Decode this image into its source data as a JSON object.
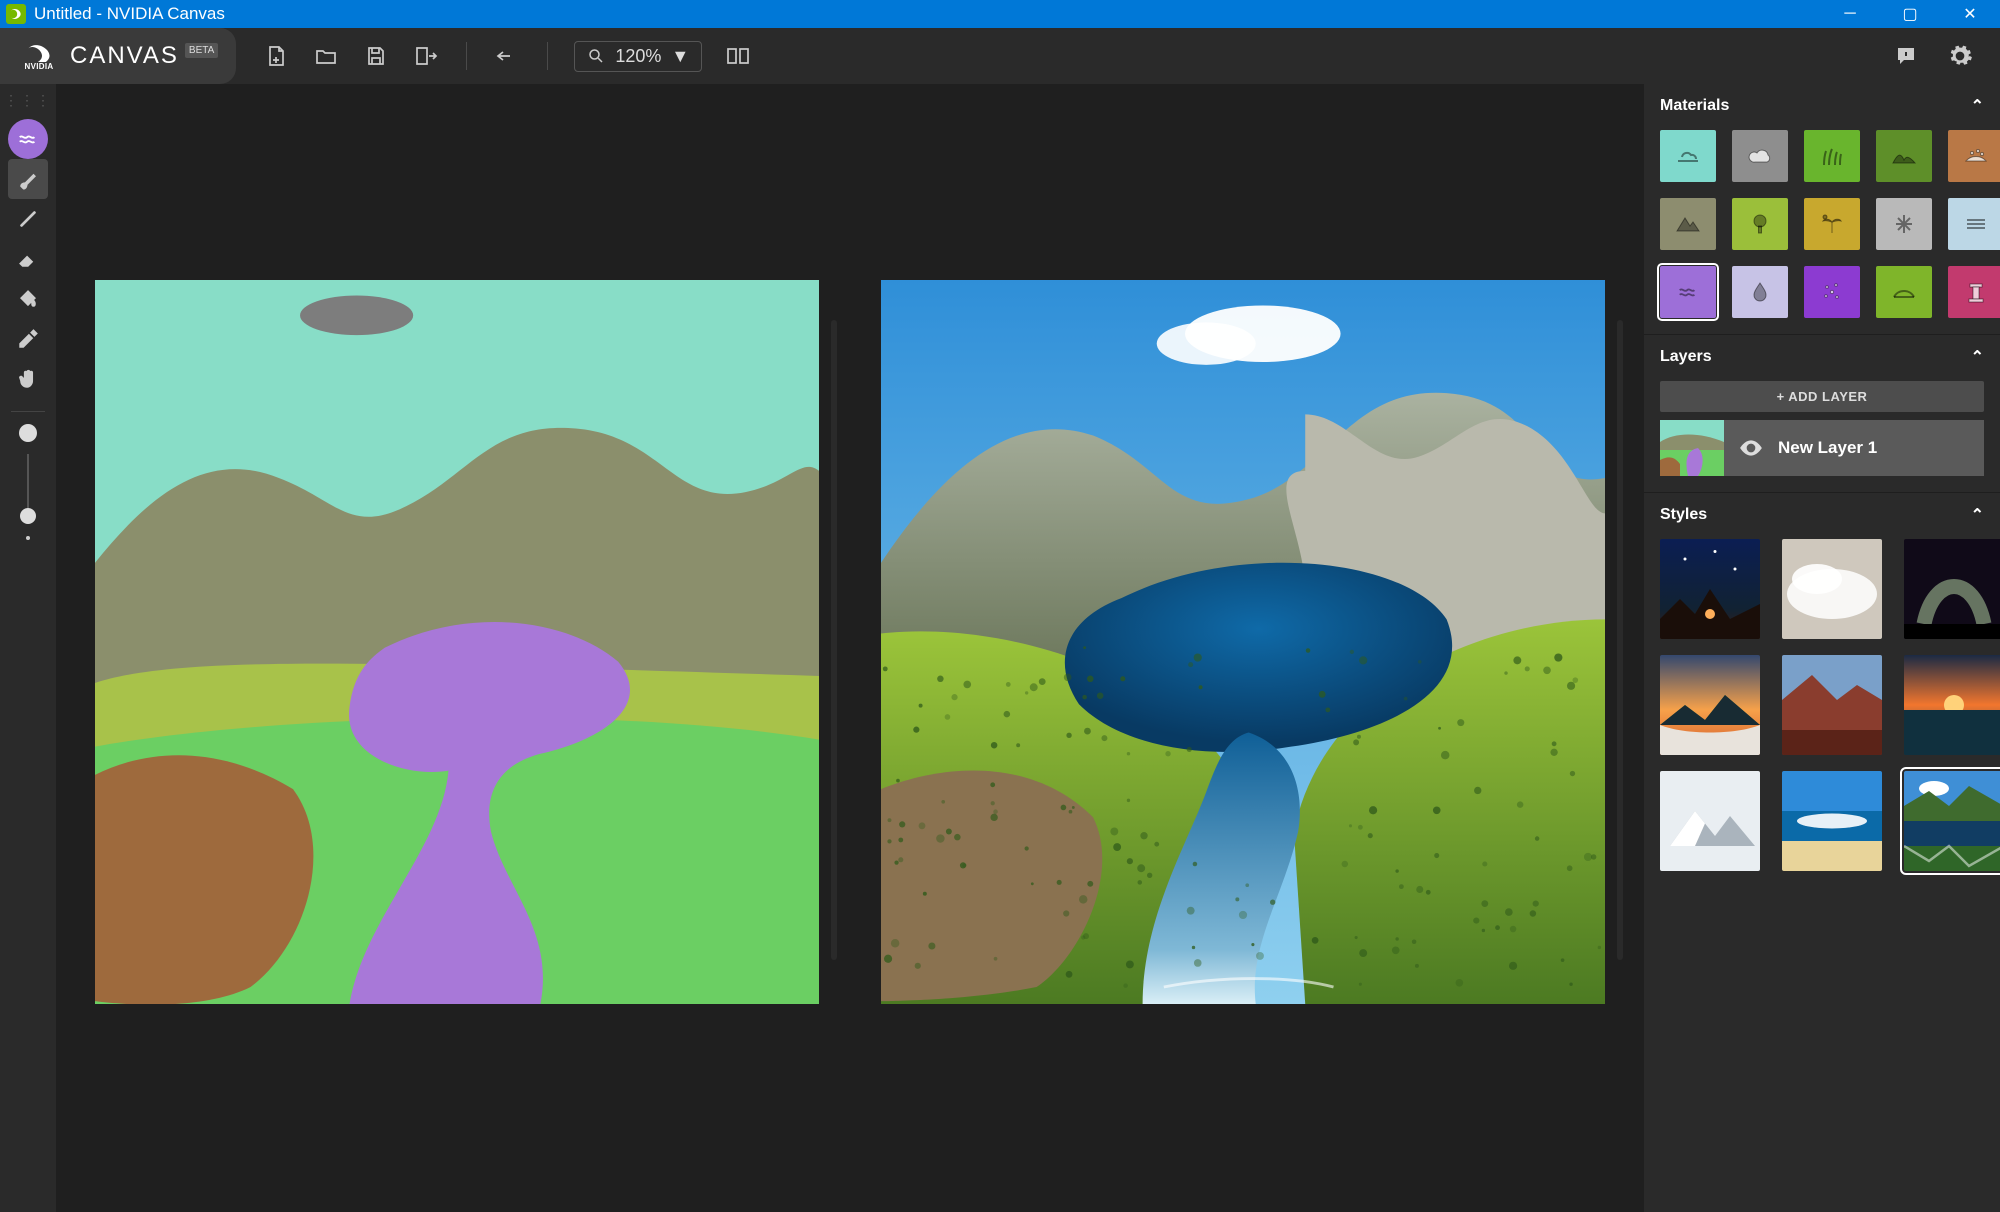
{
  "window": {
    "title": "Untitled - NVIDIA Canvas"
  },
  "brand": {
    "logo_text": "NVIDIA",
    "app_name": "CANVAS",
    "beta": "BETA"
  },
  "toolbar": {
    "zoom_value": "120%"
  },
  "left_tools": [
    {
      "name": "current-material-badge",
      "icon": "waves",
      "interact": true,
      "badge": true
    },
    {
      "name": "brush-tool",
      "icon": "brush",
      "interact": true,
      "selected": true
    },
    {
      "name": "line-tool",
      "icon": "wand",
      "interact": true
    },
    {
      "name": "eraser-tool",
      "icon": "eraser",
      "interact": true
    },
    {
      "name": "fill-tool",
      "icon": "bucket",
      "interact": true
    },
    {
      "name": "eyedropper-tool",
      "icon": "eyedropper",
      "interact": true
    },
    {
      "name": "pan-tool",
      "icon": "hand",
      "interact": true
    }
  ],
  "panels": {
    "materials": {
      "title": "Materials",
      "items": [
        {
          "name": "sky",
          "color": "#7fd9cc",
          "icon": "cloudline",
          "selected": false
        },
        {
          "name": "cloud",
          "color": "#8e8e8e",
          "icon": "cloud",
          "light": true
        },
        {
          "name": "grass",
          "color": "#69b52d",
          "icon": "grass",
          "light": true
        },
        {
          "name": "hill",
          "color": "#5e8f29",
          "icon": "hill"
        },
        {
          "name": "dirt",
          "color": "#b97846",
          "icon": "dirt",
          "light": true
        },
        {
          "name": "mountain",
          "color": "#8d8d6f",
          "icon": "mountain"
        },
        {
          "name": "tree",
          "color": "#9bbf3a",
          "icon": "tree"
        },
        {
          "name": "palm",
          "color": "#c8a82e",
          "icon": "palm"
        },
        {
          "name": "snow",
          "color": "#b9b9b9",
          "icon": "snowflake"
        },
        {
          "name": "fog",
          "color": "#bcd7e6",
          "icon": "lines"
        },
        {
          "name": "water",
          "color": "#9d6fd8",
          "icon": "waves",
          "light": true,
          "selected": true
        },
        {
          "name": "rain",
          "color": "#c7c3e6",
          "icon": "drop"
        },
        {
          "name": "stars",
          "color": "#8c3bd1",
          "icon": "sparkles",
          "light": true
        },
        {
          "name": "bush",
          "color": "#7fb52a",
          "icon": "hillline"
        },
        {
          "name": "building",
          "color": "#c23a6e",
          "icon": "pillar",
          "light": true
        }
      ]
    },
    "layers": {
      "title": "Layers",
      "add_label": "+ ADD LAYER",
      "items": [
        {
          "name": "New Layer 1",
          "visible": true
        }
      ]
    },
    "styles": {
      "title": "Styles",
      "items": [
        {
          "name": "night-desert"
        },
        {
          "name": "misty-clouds"
        },
        {
          "name": "milky-arch"
        },
        {
          "name": "sunset-ridge"
        },
        {
          "name": "red-rock"
        },
        {
          "name": "ocean-sunset"
        },
        {
          "name": "snow-peak"
        },
        {
          "name": "tropical-beach"
        },
        {
          "name": "alpine-lake",
          "selected": true
        }
      ]
    }
  },
  "colors": {
    "sky": "#88ddc7",
    "cloud": "#7d7d7d",
    "mountain": "#8b8f6c",
    "field1": "#a8c24a",
    "meadow": "#6bcf63",
    "water": "#a878d8",
    "dirt": "#9e6a3d"
  }
}
